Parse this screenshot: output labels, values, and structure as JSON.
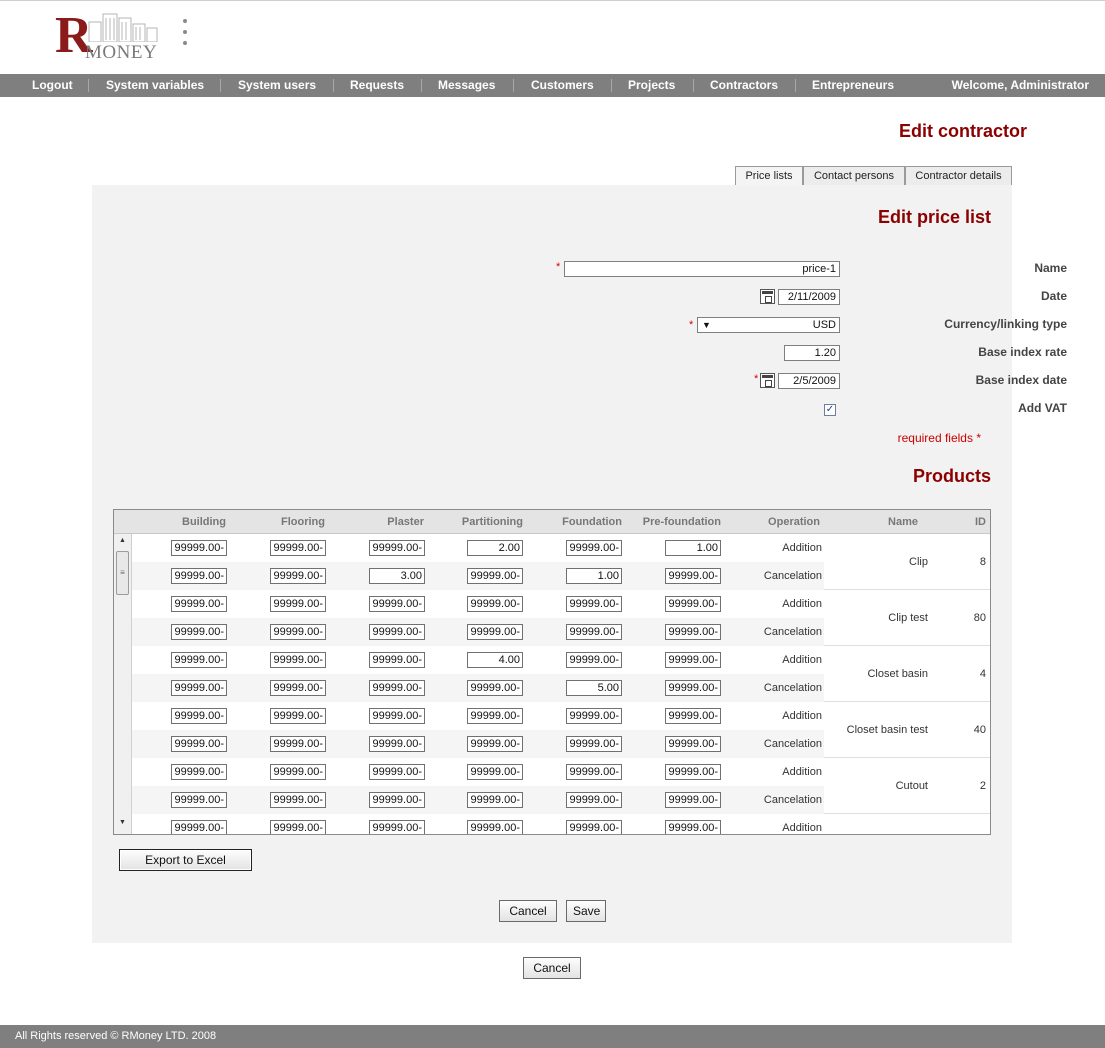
{
  "logo": {
    "letter": "R",
    "word": "MONEY"
  },
  "nav": {
    "items": [
      "Logout",
      "System variables",
      "System users",
      "Requests",
      "Messages",
      "Customers",
      "Projects",
      "Contractors",
      "Entrepreneurs"
    ],
    "welcome": "Welcome, Administrator"
  },
  "page_title": "Edit contractor",
  "tabs": [
    "Price lists",
    "Contact persons",
    "Contractor details"
  ],
  "form": {
    "heading": "Edit price list",
    "name_label": "Name",
    "name_value": "price-1",
    "date_label": "Date",
    "date_value": "2/11/2009",
    "currency_label": "Currency/linking type",
    "currency_value": "USD",
    "base_rate_label": "Base index rate",
    "base_rate_value": "1.20",
    "base_date_label": "Base index date",
    "base_date_value": "2/5/2009",
    "vat_label": "Add VAT",
    "vat_checked": "✓",
    "required_note": "required fields *",
    "asterisk": "*"
  },
  "products": {
    "heading": "Products",
    "columns": [
      "Building",
      "Flooring",
      "Plaster",
      "Partitioning",
      "Foundation",
      "Pre-foundation",
      "Operation",
      "Name",
      "ID"
    ],
    "rows": [
      {
        "cells": [
          "99999.00-",
          "99999.00-",
          "99999.00-",
          "2.00",
          "99999.00-",
          "1.00"
        ],
        "op": "Addition"
      },
      {
        "cells": [
          "99999.00-",
          "99999.00-",
          "3.00",
          "99999.00-",
          "1.00",
          "99999.00-"
        ],
        "op": "Cancelation"
      },
      {
        "cells": [
          "99999.00-",
          "99999.00-",
          "99999.00-",
          "99999.00-",
          "99999.00-",
          "99999.00-"
        ],
        "op": "Addition"
      },
      {
        "cells": [
          "99999.00-",
          "99999.00-",
          "99999.00-",
          "99999.00-",
          "99999.00-",
          "99999.00-"
        ],
        "op": "Cancelation"
      },
      {
        "cells": [
          "99999.00-",
          "99999.00-",
          "99999.00-",
          "4.00",
          "99999.00-",
          "99999.00-"
        ],
        "op": "Addition"
      },
      {
        "cells": [
          "99999.00-",
          "99999.00-",
          "99999.00-",
          "99999.00-",
          "5.00",
          "99999.00-"
        ],
        "op": "Cancelation"
      },
      {
        "cells": [
          "99999.00-",
          "99999.00-",
          "99999.00-",
          "99999.00-",
          "99999.00-",
          "99999.00-"
        ],
        "op": "Addition"
      },
      {
        "cells": [
          "99999.00-",
          "99999.00-",
          "99999.00-",
          "99999.00-",
          "99999.00-",
          "99999.00-"
        ],
        "op": "Cancelation"
      },
      {
        "cells": [
          "99999.00-",
          "99999.00-",
          "99999.00-",
          "99999.00-",
          "99999.00-",
          "99999.00-"
        ],
        "op": "Addition"
      },
      {
        "cells": [
          "99999.00-",
          "99999.00-",
          "99999.00-",
          "99999.00-",
          "99999.00-",
          "99999.00-"
        ],
        "op": "Cancelation"
      },
      {
        "cells": [
          "99999.00-",
          "99999.00-",
          "99999.00-",
          "99999.00-",
          "99999.00-",
          "99999.00-"
        ],
        "op": "Addition"
      }
    ],
    "items": [
      {
        "name": "Clip",
        "id": "8"
      },
      {
        "name": "Clip test",
        "id": "80"
      },
      {
        "name": "Closet basin",
        "id": "4"
      },
      {
        "name": "Closet basin test",
        "id": "40"
      },
      {
        "name": "Cutout",
        "id": "2"
      }
    ]
  },
  "buttons": {
    "export": "Export to Excel",
    "cancel": "Cancel",
    "save": "Save",
    "cancel_outer": "Cancel"
  },
  "footer": "All Rights reserved © RMoney LTD. 2008",
  "colors": {
    "accent": "#8b0000",
    "nav": "#7f7f7f",
    "panel": "#f3f2f2"
  }
}
